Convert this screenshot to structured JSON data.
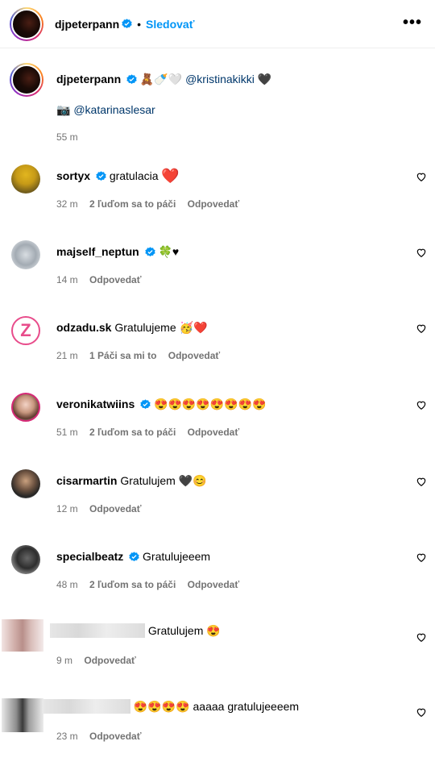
{
  "header": {
    "username": "djpeterpann",
    "dot": "•",
    "follow_label": "Sledovať",
    "more_label": "•••"
  },
  "caption": {
    "username": "djpeterpann",
    "emojis": "🧸🍼🤍",
    "mention1": "@kristinakikki",
    "heart": "🖤",
    "camera": "📷",
    "mention2": "@katarinaslesar",
    "time": "55 m"
  },
  "comments": [
    {
      "user": "sortyx",
      "verified": true,
      "text": "gratulacia",
      "emoji": "❤️",
      "time": "32 m",
      "likes": "2 ľuďom sa to páči",
      "reply": "Odpovedať"
    },
    {
      "user": "majself_neptun",
      "verified": true,
      "text": "",
      "emoji": "🍀♥",
      "time": "14 m",
      "likes": "",
      "reply": "Odpovedať"
    },
    {
      "user": "odzadu.sk",
      "verified": false,
      "text": "Gratulujeme",
      "emoji": "🥳❤️",
      "time": "21 m",
      "likes": "1 Páči sa mi to",
      "reply": "Odpovedať"
    },
    {
      "user": "veronikatwiins",
      "verified": true,
      "text": "",
      "emoji": "😍😍😍😍😍😍😍😍",
      "time": "51 m",
      "likes": "2 ľuďom sa to páči",
      "reply": "Odpovedať"
    },
    {
      "user": "cisarmartin",
      "verified": false,
      "text": "Gratulujem",
      "emoji": "🖤😊",
      "time": "12 m",
      "likes": "",
      "reply": "Odpovedať"
    },
    {
      "user": "specialbeatz",
      "verified": true,
      "text": "Gratulujeeem",
      "emoji": "",
      "time": "48 m",
      "likes": "2 ľuďom sa to páči",
      "reply": "Odpovedať"
    },
    {
      "user": "",
      "verified": false,
      "text": "Gratulujem",
      "emoji": "😍",
      "time": "9 m",
      "likes": "",
      "reply": "Odpovedať"
    },
    {
      "user": "",
      "verified": false,
      "text": "aaaaa gratulujeeeem",
      "emoji": "😍😍😍😍",
      "time": "23 m",
      "likes": "",
      "reply": "Odpovedať"
    }
  ],
  "icons": {
    "verified": "verified-badge-icon",
    "heart": "heart-outline-icon",
    "more": "more-options-icon"
  },
  "colors": {
    "link": "#0095f6",
    "mention": "#00376b",
    "meta": "#737373",
    "verified": "#0095f6"
  }
}
